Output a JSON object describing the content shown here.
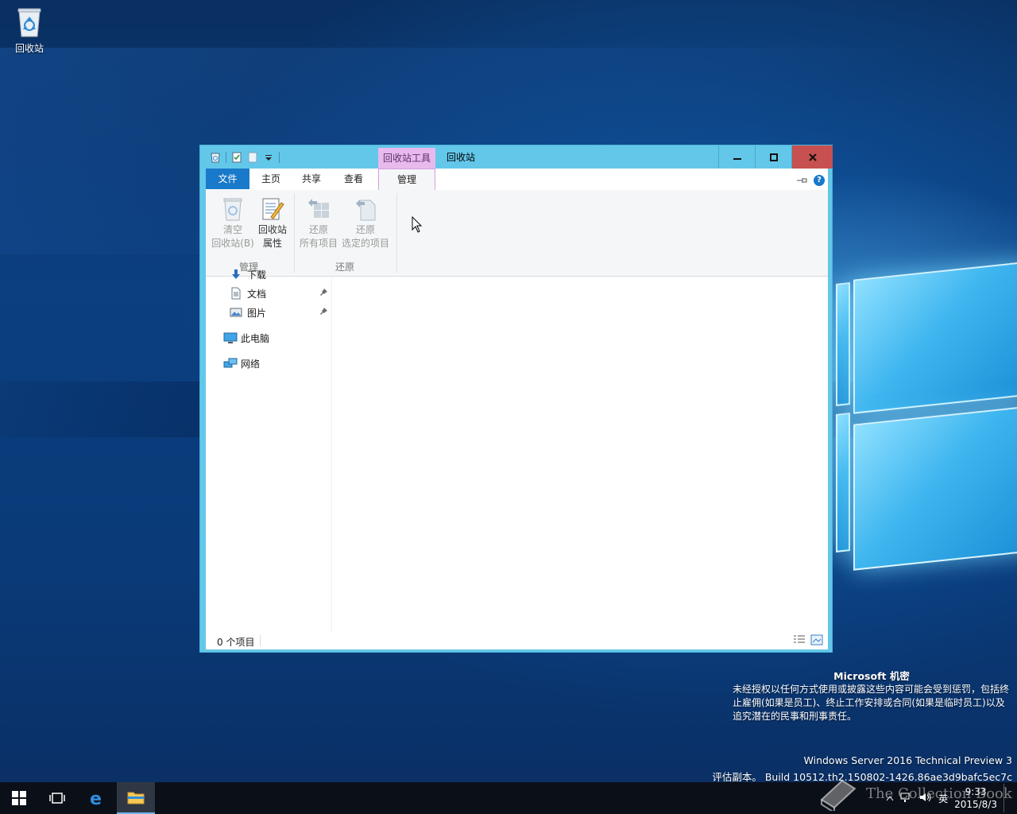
{
  "desktop": {
    "icons": [
      {
        "label": "回收站"
      }
    ]
  },
  "window": {
    "title": "回收站",
    "context_tab_header": "回收站工具",
    "controls": {
      "minimize": "minimize",
      "maximize": "maximize",
      "close": "close"
    }
  },
  "ribbon": {
    "tabs": [
      "文件",
      "主页",
      "共享",
      "查看",
      "管理"
    ],
    "active_tab": "管理",
    "groups": [
      {
        "label": "管理",
        "buttons": [
          {
            "line1": "清空",
            "line2": "回收站(B)",
            "enabled": false,
            "icon": "empty-recycle-bin-icon"
          },
          {
            "line1": "回收站",
            "line2": "属性",
            "enabled": true,
            "icon": "recycle-bin-properties-icon"
          }
        ]
      },
      {
        "label": "还原",
        "buttons": [
          {
            "line1": "还原",
            "line2": "所有项目",
            "enabled": false,
            "icon": "restore-all-icon"
          },
          {
            "line1": "还原",
            "line2": "选定的项目",
            "enabled": false,
            "icon": "restore-selected-icon"
          }
        ]
      }
    ]
  },
  "nav": {
    "items": [
      {
        "label": "下载",
        "icon": "download-icon",
        "pinned": true
      },
      {
        "label": "文档",
        "icon": "documents-icon",
        "pinned": true
      },
      {
        "label": "图片",
        "icon": "pictures-icon",
        "pinned": true
      },
      {
        "label": "此电脑",
        "icon": "this-pc-icon",
        "pinned": false
      },
      {
        "label": "网络",
        "icon": "network-icon",
        "pinned": false
      }
    ]
  },
  "status": {
    "item_count": "0 个项目"
  },
  "watermark": {
    "title": "Microsoft 机密",
    "body": "未经授权以任何方式使用或披露这些内容可能会受到惩罚，包括终止雇佣(如果是员工)、终止工作安排或合同(如果是临时员工)以及追究潜在的民事和刑事责任。",
    "os_name": "Windows Server 2016 Technical Preview 3",
    "build": "评估副本。 Build 10512.th2.150802-1426.86ae3d9bafc5ec7c"
  },
  "taskbar": {
    "time": "9:33",
    "date": "2015/8/3",
    "ime": "英",
    "overlay_brand": "The Collection Book"
  },
  "colors": {
    "window_frame": "#63c7ea",
    "context_tab": "#e8b9ec",
    "file_tab": "#1979ca",
    "close_button": "#c75050"
  }
}
